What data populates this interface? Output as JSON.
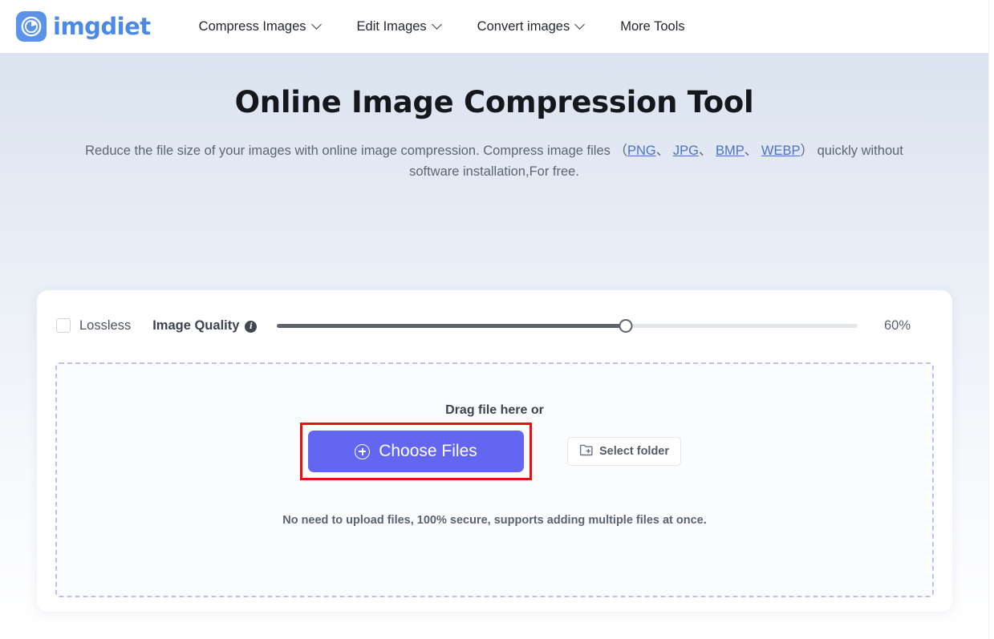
{
  "brand": {
    "name": "imgdiet",
    "logo_icon": "pie-chart-circle-logo-icon",
    "logo_color": "#4a8ae6"
  },
  "nav": {
    "items": [
      {
        "label": "Compress Images",
        "has_dropdown": true
      },
      {
        "label": "Edit Images",
        "has_dropdown": true
      },
      {
        "label": "Convert images",
        "has_dropdown": true
      },
      {
        "label": "More Tools",
        "has_dropdown": false
      }
    ]
  },
  "hero": {
    "title": "Online Image Compression Tool",
    "subtitle_part1": "Reduce the file size of your images with online image compression. Compress image files",
    "open_paren": "（",
    "formats": [
      {
        "label": "PNG",
        "sep": "、"
      },
      {
        "label": "JPG",
        "sep": "、"
      },
      {
        "label": "BMP",
        "sep": "、"
      },
      {
        "label": "WEBP",
        "sep": ""
      }
    ],
    "close_paren": "）",
    "subtitle_part2": "quickly without software installation,For free."
  },
  "quality": {
    "lossless_label": "Lossless",
    "lossless_checked": false,
    "image_quality_label": "Image Quality",
    "info_icon": "info-icon",
    "info_glyph": "i",
    "value_percent": 60,
    "value_display": "60%",
    "fill_color": "#5d646e",
    "track_color": "#e3e7ec"
  },
  "dropzone": {
    "drag_text": "Drag file here or",
    "choose_files_label": "Choose Files",
    "choose_files_icon": "plus-circle-icon",
    "choose_files_color": "#6366f1",
    "select_folder_label": "Select folder",
    "select_folder_icon": "folder-add-icon",
    "note": "No need to upload files, 100% secure, supports adding multiple files at once.",
    "border_color": "#bcc3ea",
    "highlight_color": "#e11313"
  }
}
